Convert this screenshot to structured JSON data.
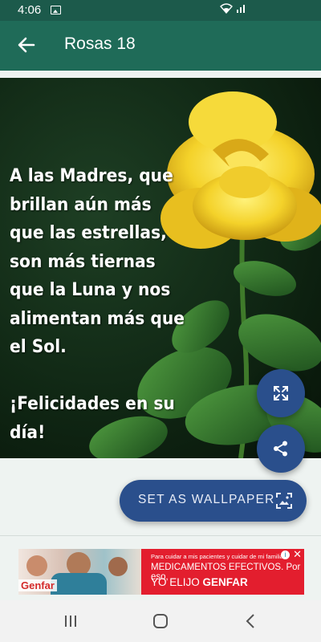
{
  "status": {
    "time": "4:06"
  },
  "app_bar": {
    "title": "Rosas 18"
  },
  "image": {
    "quote": " A las Madres, que\nbrillan aún más\nque las estrellas,\nson más tiernas\nque la Luna y nos\nalimentan más que\nel Sol.\n\n¡Felicidades en su día!"
  },
  "actions": {
    "set_wallpaper_label": "SET AS WALLPAPER"
  },
  "ad": {
    "brand": "Genfar",
    "line1": "Para cuidar a mis pacientes y cuidar de mi familia",
    "line2": "MEDICAMENTOS EFECTIVOS. Por eso,",
    "line3_prefix": "YO ELIJO ",
    "line3_brand": "GENFAR"
  },
  "colors": {
    "primary": "#1f6b58",
    "status_bar": "#1c5a4b",
    "fab": "#2a4f8c",
    "ad_red": "#e31e2e"
  }
}
